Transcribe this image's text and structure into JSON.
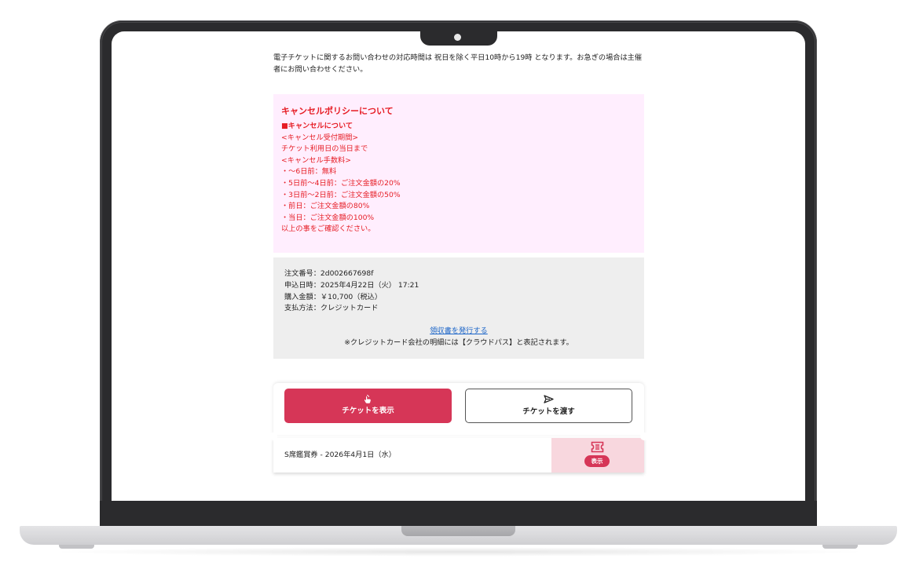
{
  "notice_text": "電子チケットに関するお問い合わせの対応時間は 祝日を除く平日10時から19時 となります。お急ぎの場合は主催者にお問い合わせください。",
  "cancel_policy": {
    "title": "キャンセルポリシーについて",
    "subtitle": "■キャンセルについて",
    "lines": [
      "<キャンセル受付期間>",
      "チケット利用日の当日まで",
      "<キャンセル手数料>",
      "・〜6日前：無料",
      "・5日前〜4日前：ご注文金額の20%",
      "・3日前〜2日前：ご注文金額の50%",
      "・前日：ご注文金額の80%",
      "・当日：ご注文金額の100%",
      "以上の事をご確認ください。"
    ]
  },
  "order": {
    "number": "注文番号：2d002667698f",
    "date": "申込日時：2025年4月22日（火） 17:21",
    "amount": "購入金額：￥10,700（税込）",
    "payment": "支払方法：クレジットカード",
    "receipt_link": "領収書を発行する",
    "card_note": "※クレジットカード会社の明細には【クラウドパス】と表記されます。"
  },
  "actions": {
    "show_ticket": "チケットを表示",
    "pass_ticket": "チケットを渡す"
  },
  "ticket": {
    "name": "S席鑑賞券 - 2026年4月1日（水）",
    "show_badge": "表示"
  },
  "colors": {
    "policy_bg": "#ffeefe",
    "policy_text": "#e61c24",
    "primary": "#d63657",
    "link": "#1a64c8",
    "order_bg": "#eeeeee",
    "stub_bg": "#f8d7de"
  }
}
